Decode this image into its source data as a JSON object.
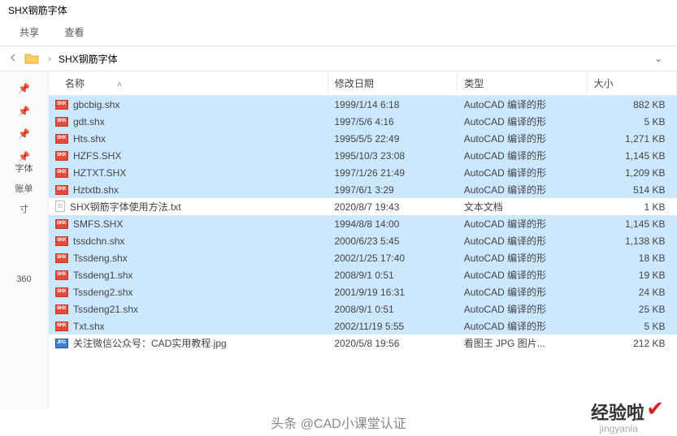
{
  "title": "SHX钢筋字体",
  "tabs": {
    "share": "共享",
    "view": "查看"
  },
  "breadcrumb": {
    "folder": "SHX钢筋字体"
  },
  "sidebar": {
    "items": [
      {
        "label": ""
      },
      {
        "label": ""
      },
      {
        "label": ""
      },
      {
        "label": "字体"
      },
      {
        "label": "账单"
      },
      {
        "label": "寸"
      },
      {
        "label": "360"
      }
    ]
  },
  "columns": {
    "name": "名称",
    "date": "修改日期",
    "type": "类型",
    "size": "大小"
  },
  "files": [
    {
      "ico": "shx",
      "sel": true,
      "name": "gbcbig.shx",
      "date": "1999/1/14 6:18",
      "type": "AutoCAD 编译的形",
      "size": "882 KB"
    },
    {
      "ico": "shx",
      "sel": true,
      "name": "gdt.shx",
      "date": "1997/5/6 4:16",
      "type": "AutoCAD 编译的形",
      "size": "5 KB"
    },
    {
      "ico": "shx",
      "sel": true,
      "name": "Hts.shx",
      "date": "1995/5/5 22:49",
      "type": "AutoCAD 编译的形",
      "size": "1,271 KB"
    },
    {
      "ico": "shx",
      "sel": true,
      "name": "HZFS.SHX",
      "date": "1995/10/3 23:08",
      "type": "AutoCAD 编译的形",
      "size": "1,145 KB"
    },
    {
      "ico": "shx",
      "sel": true,
      "name": "HZTXT.SHX",
      "date": "1997/1/26 21:49",
      "type": "AutoCAD 编译的形",
      "size": "1,209 KB"
    },
    {
      "ico": "shx",
      "sel": true,
      "name": "Hztxtb.shx",
      "date": "1997/6/1 3:29",
      "type": "AutoCAD 编译的形",
      "size": "514 KB"
    },
    {
      "ico": "txt",
      "sel": false,
      "name": "SHX钢筋字体使用方法.txt",
      "date": "2020/8/7 19:43",
      "type": "文本文档",
      "size": "1 KB"
    },
    {
      "ico": "shx",
      "sel": true,
      "name": "SMFS.SHX",
      "date": "1994/8/8 14:00",
      "type": "AutoCAD 编译的形",
      "size": "1,145 KB"
    },
    {
      "ico": "shx",
      "sel": true,
      "name": "tssdchn.shx",
      "date": "2000/6/23 5:45",
      "type": "AutoCAD 编译的形",
      "size": "1,138 KB"
    },
    {
      "ico": "shx",
      "sel": true,
      "name": "Tssdeng.shx",
      "date": "2002/1/25 17:40",
      "type": "AutoCAD 编译的形",
      "size": "18 KB"
    },
    {
      "ico": "shx",
      "sel": true,
      "name": "Tssdeng1.shx",
      "date": "2008/9/1 0:51",
      "type": "AutoCAD 编译的形",
      "size": "19 KB"
    },
    {
      "ico": "shx",
      "sel": true,
      "name": "Tssdeng2.shx",
      "date": "2001/9/19 16:31",
      "type": "AutoCAD 编译的形",
      "size": "24 KB"
    },
    {
      "ico": "shx",
      "sel": true,
      "name": "Tssdeng21.shx",
      "date": "2008/9/1 0:51",
      "type": "AutoCAD 编译的形",
      "size": "25 KB"
    },
    {
      "ico": "shx",
      "sel": true,
      "name": "Txt.shx",
      "date": "2002/11/19 5:55",
      "type": "AutoCAD 编译的形",
      "size": "5 KB"
    },
    {
      "ico": "jpg",
      "sel": false,
      "name": "关注微信公众号：CAD实用教程.jpg",
      "date": "2020/5/8 19:56",
      "type": "看图王 JPG 图片...",
      "size": "212 KB"
    }
  ],
  "footer": "头条 @CAD小课堂认证",
  "watermark": {
    "main": "经验啦",
    "sub": "jingyanla"
  }
}
